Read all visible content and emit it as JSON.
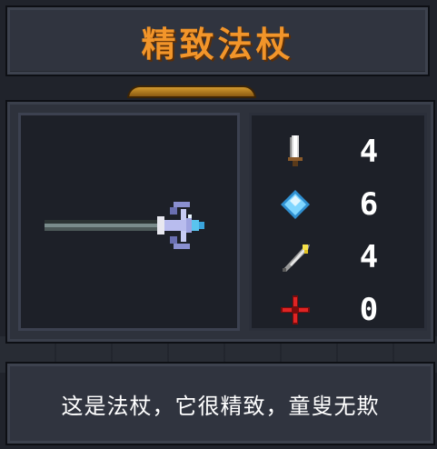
{
  "weapon": {
    "name": "精致法杖",
    "description": "这是法杖，它很精致，童叟无欺",
    "item_icon": "staff-icon"
  },
  "stats": [
    {
      "icon": "sword-icon",
      "label": "damage",
      "value": "4",
      "color": "#c9c9c9"
    },
    {
      "icon": "diamond-icon",
      "label": "energy-cost",
      "value": "6",
      "color": "#7fd6ff"
    },
    {
      "icon": "feather-icon",
      "label": "crit",
      "value": "4",
      "color": "#f5e14a"
    },
    {
      "icon": "crosshair-icon",
      "label": "inaccuracy",
      "value": "0",
      "color": "#d21c1c"
    }
  ],
  "colors": {
    "title": "#f2952a",
    "panel": "#30343f",
    "panel_dark": "#1d2028"
  }
}
